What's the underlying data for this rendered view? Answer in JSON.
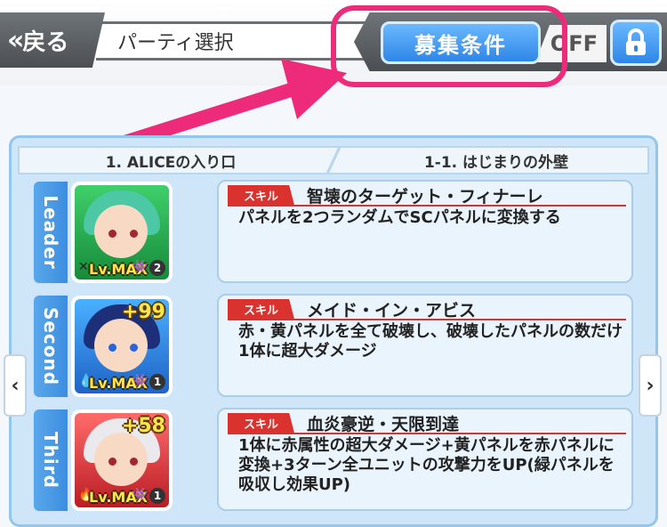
{
  "header": {
    "back_label": "戻る",
    "back_chevron": "«",
    "title": "パーティ選択",
    "recruit_label": "募集条件",
    "toggle_label": "OFF",
    "lock_icon": "lock-icon"
  },
  "tabs": {
    "left": "1. ALICEの入り口",
    "right": "1-1. はじまりの外壁"
  },
  "members": [
    {
      "slot": "Leader",
      "plus": "",
      "level": "Lv.MAX",
      "rank": "2",
      "skill_badge": "スキル",
      "skill_name": "智壊のターゲット・フィナーレ",
      "skill_desc": "パネルを2つランダムでSCパネルに変換する"
    },
    {
      "slot": "Second",
      "plus": "+99",
      "level": "Lv.MAX",
      "rank": "1",
      "skill_badge": "スキル",
      "skill_name": "メイド・イン・アビス",
      "skill_desc": "赤・黄パネルを全て破壊し、破壊したパネルの数だけ1体に超大ダメージ"
    },
    {
      "slot": "Third",
      "plus": "+58",
      "level": "Lv.MAX",
      "rank": "1",
      "skill_badge": "スキル",
      "skill_name": "血炎豪逆・天限到達",
      "skill_desc": "1体に赤属性の超大ダメージ+黄パネルを赤パネルに変換+3ターン全ユニットの攻撃力をUP(緑パネルを吸収し効果UP)"
    }
  ],
  "nav": {
    "prev": "‹",
    "next": "›"
  },
  "colors": {
    "accent_blue": "#2f86e6",
    "highlight_pink": "#ee2b7b",
    "skill_red": "#d9322f"
  }
}
